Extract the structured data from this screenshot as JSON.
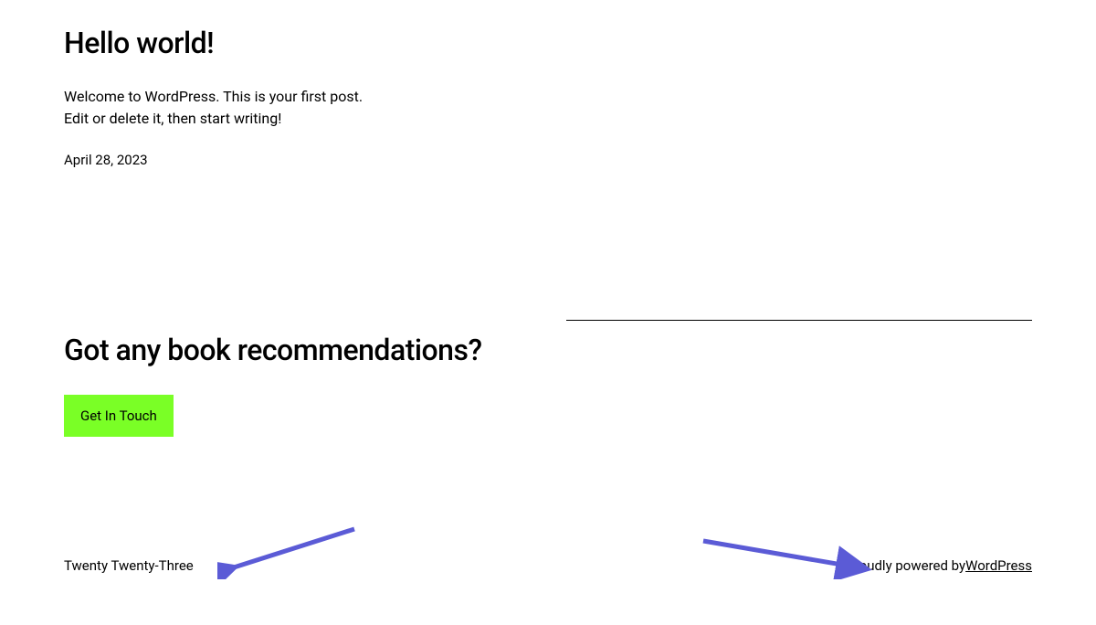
{
  "post": {
    "title": "Hello world!",
    "excerpt_line1": "Welcome to WordPress. This is your first post.",
    "excerpt_line2": "Edit or delete it, then start writing!",
    "date": "April 28, 2023"
  },
  "cta": {
    "heading": "Got any book recommendations?",
    "button_label": "Get In Touch"
  },
  "footer": {
    "theme_name": "Twenty Twenty-Three",
    "powered_by_prefix": "Proudly powered by ",
    "powered_by_link": "WordPress"
  },
  "colors": {
    "button_bg": "#7aff26",
    "arrow": "#5b5bd6"
  }
}
